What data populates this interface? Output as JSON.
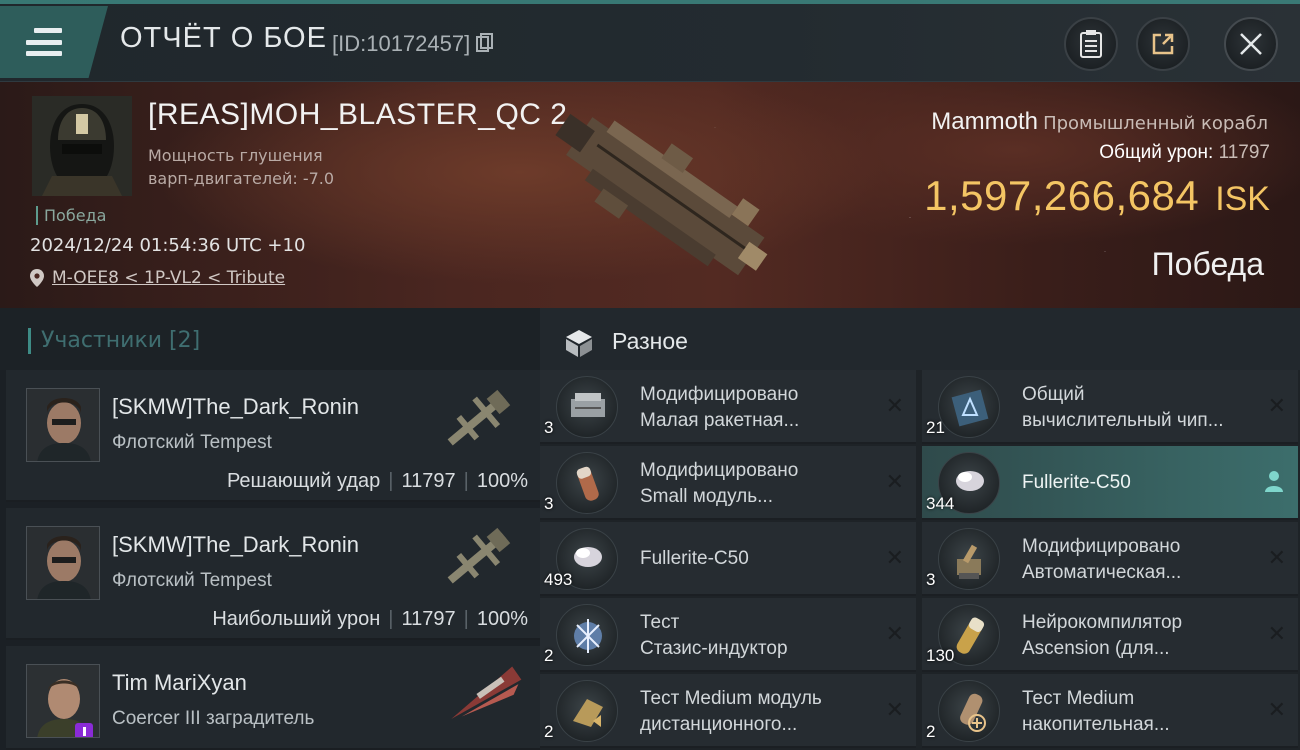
{
  "header": {
    "title": "ОТЧЁТ О БОЕ",
    "report_id": "[ID:10172457]",
    "buttons": {
      "menu": "menu-icon",
      "clipboard": "clipboard-icon",
      "share": "share-icon",
      "close": "close-icon"
    }
  },
  "victim": {
    "name": "[REAS]MOH_BLASTER_QC 2",
    "attribute_line1": "Мощность глушения",
    "attribute_line2": "варп-двигателей: -7.0",
    "status": "Победа",
    "datetime": "2024/12/24 01:54:36 UTC +10",
    "location": "M-OEE8 < 1P-VL2 < Tribute",
    "ship_name": "Mammoth",
    "ship_class": "Промышленный корабл",
    "total_damage_label": "Общий урон:",
    "total_damage_value": "11797",
    "isk_value": "1,597,266,684",
    "isk_unit": "ISK",
    "outcome": "Победа"
  },
  "participants": {
    "title": "Участники [2]",
    "rows": [
      {
        "name": "[SKMW]The_Dark_Ronin",
        "ship": "Флотский Tempest",
        "role": "Решающий удар",
        "damage": "11797",
        "percent": "100%"
      },
      {
        "name": "[SKMW]The_Dark_Ronin",
        "ship": "Флотский Tempest",
        "role": "Наибольший урон",
        "damage": "11797",
        "percent": "100%"
      },
      {
        "name": "Tim MariXyan",
        "ship": "Coercer III заградитель",
        "role": "",
        "damage": "",
        "percent": ""
      }
    ]
  },
  "misc": {
    "title": "Разное",
    "items_left": [
      {
        "qty": "3",
        "name": "Модифицировано\nМалая ракетная...",
        "icon": "launcher-icon"
      },
      {
        "qty": "3",
        "name": "Модифицировано\nSmall модуль...",
        "icon": "module-icon"
      },
      {
        "qty": "493",
        "name": "Fullerite-C50",
        "icon": "gas-icon"
      },
      {
        "qty": "2",
        "name": "Тест\nСтазис-индуктор",
        "icon": "stasis-icon"
      },
      {
        "qty": "2",
        "name": "Тест Medium модуль\nдистанционного...",
        "icon": "remote-module-icon"
      }
    ],
    "items_right": [
      {
        "qty": "21",
        "name": "Общий\nвычислительный чип...",
        "icon": "chip-icon"
      },
      {
        "qty": "344",
        "name": "Fullerite-C50",
        "icon": "gas-icon"
      },
      {
        "qty": "3",
        "name": "Модифицировано\nАвтоматическая...",
        "icon": "turret-icon"
      },
      {
        "qty": "130",
        "name": "Нейрокомпилятор\nAscension (для...",
        "icon": "neuro-icon"
      },
      {
        "qty": "2",
        "name": "Тест Medium\nнакопительная...",
        "icon": "capacitor-icon"
      }
    ]
  }
}
